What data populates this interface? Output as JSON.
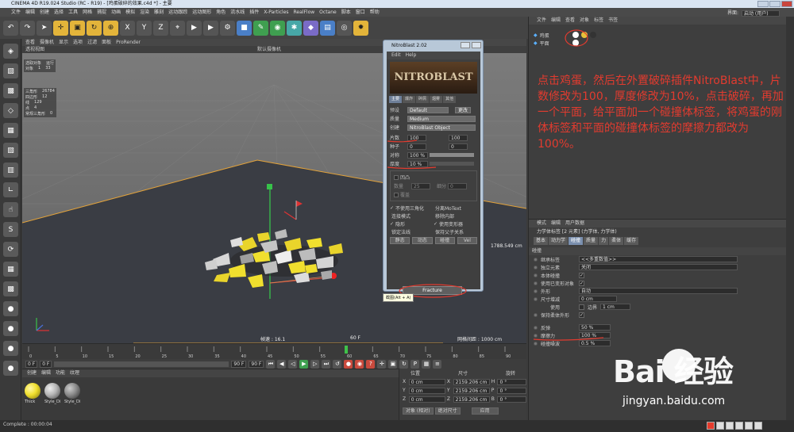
{
  "window": {
    "title": "CINEMA 4D R19.024 Studio (RC - R19) - [鸡蛋破碎的效果.c4d *] - 主要"
  },
  "menubar": {
    "items": [
      "文件",
      "编辑",
      "创建",
      "选择",
      "工具",
      "网格",
      "捕捉",
      "动画",
      "模拟",
      "渲染",
      "雕刻",
      "运动跟踪",
      "运动图形",
      "角色",
      "流水线",
      "插件",
      "X-Particles",
      "RealFlow",
      "Octane",
      "脚本",
      "窗口",
      "帮助"
    ],
    "layout_label": "界面:",
    "layout_value": "启动 (用户)"
  },
  "viewport": {
    "menu": [
      "查看",
      "摄像机",
      "显示",
      "选项",
      "过滤",
      "面板",
      "ProRender"
    ],
    "view_name": "透视视图",
    "camera_label": "默认摄像机",
    "stats_header": [
      "选取对象",
      "运行"
    ],
    "stats_header_row": [
      "对象",
      "1",
      "33"
    ],
    "stats": [
      {
        "label": "三角形",
        "value": "26784"
      },
      {
        "label": "四边形",
        "value": "12"
      },
      {
        "label": "线",
        "value": "129"
      },
      {
        "label": "点",
        "value": "4"
      },
      {
        "label": "常规三角形",
        "value": "0"
      }
    ],
    "fps": "帧速 : 16.1",
    "frame_label": "60 F",
    "distance": "1788.549 cm",
    "grid_spacing": "网格间距 : 1000 cm"
  },
  "timeline": {
    "ticks": [
      "0",
      "5",
      "10",
      "15",
      "20",
      "25",
      "30",
      "35",
      "40",
      "45",
      "50",
      "55",
      "60",
      "65",
      "70",
      "75",
      "80",
      "85",
      "90"
    ],
    "current_frame": 60,
    "start_field": "0 F",
    "range_start": "0 F",
    "range_end": "90 F",
    "end_field": "90 F",
    "frame_field": "60 F"
  },
  "material_panel": {
    "menu": [
      "创建",
      "编辑",
      "功能",
      "纹理"
    ],
    "materials": [
      {
        "name": "Thick",
        "color": "#f0df2e"
      },
      {
        "name": "Style_Di",
        "color": "#b5b5b5"
      },
      {
        "name": "Style_Di",
        "color": "#8a8a8a"
      }
    ]
  },
  "coordinates": {
    "headers": [
      "位置",
      "尺寸",
      "旋转"
    ],
    "rows": [
      {
        "axis": "X",
        "pos": "0 cm",
        "size": "2159.206 cm",
        "rot_axis": "H",
        "rot": "0 °"
      },
      {
        "axis": "Y",
        "pos": "0 cm",
        "size": "2159.206 cm",
        "rot_axis": "P",
        "rot": "0 °"
      },
      {
        "axis": "Z",
        "pos": "0 cm",
        "size": "2159.206 cm",
        "rot_axis": "B",
        "rot": "0 °"
      }
    ],
    "mode": "对象 (相对)",
    "size_mode": "绝对尺寸",
    "apply": "应用"
  },
  "object_manager": {
    "menu": [
      "文件",
      "编辑",
      "查看",
      "对象",
      "标签",
      "书签"
    ],
    "objects": [
      {
        "name": "鸡蛋",
        "tags": [
          "#ffffff",
          "#e8c23a",
          "#333333"
        ]
      },
      {
        "name": "平面",
        "tags": [
          "#ffffff"
        ]
      }
    ]
  },
  "attributes": {
    "menu": [
      "模式",
      "编辑",
      "用户数据"
    ],
    "title": "力学体标签 [2 元素] (力学体, 力学体)",
    "tabs": [
      {
        "label": "基本",
        "on": false
      },
      {
        "label": "动力学",
        "on": false
      },
      {
        "label": "碰撞",
        "on": true
      },
      {
        "label": "质量",
        "on": false
      },
      {
        "label": "力",
        "on": false
      },
      {
        "label": "柔体",
        "on": false
      },
      {
        "label": "缓存",
        "on": false
      }
    ],
    "section": "碰撞",
    "rows": [
      {
        "label": "继承标签",
        "value": "<<多重数值>>",
        "type": "select"
      },
      {
        "label": "独立元素",
        "value": "关闭",
        "type": "select"
      },
      {
        "label": "本体碰撞",
        "value": "✓",
        "type": "check"
      },
      {
        "label": "使用已变形对象",
        "value": "✓",
        "type": "check"
      },
      {
        "label": "外形",
        "value": "自动",
        "type": "select"
      },
      {
        "label": "尺寸增减",
        "value": "0 cm",
        "type": "field"
      },
      {
        "label": "使用",
        "value": "边界",
        "value2": "1 cm",
        "type": "double"
      },
      {
        "label": "保持柔体外形",
        "value": "✓",
        "type": "check"
      },
      {
        "label": "反弹",
        "value": "50 %",
        "type": "field"
      },
      {
        "label": "摩擦力",
        "value": "100 %",
        "type": "field"
      },
      {
        "label": "碰撞噪波",
        "value": "0.5 %",
        "type": "field"
      }
    ]
  },
  "nitroblast": {
    "title": "NitroBlast 2.02",
    "menu": [
      "Edit",
      "Help"
    ],
    "logo": "NITROBLAST",
    "tabs": [
      {
        "label": "主要",
        "on": true
      },
      {
        "label": "爆炸",
        "on": false
      },
      {
        "label": "碎屑",
        "on": false
      },
      {
        "label": "烟雾",
        "on": false
      },
      {
        "label": "其他",
        "on": false
      }
    ],
    "preset_label": "预设",
    "preset_value": "Default",
    "preset_btn": "更改",
    "quality_label": "质量",
    "quality_value": "Medium",
    "create_label": "创建",
    "create_value": "NitroBlast Object",
    "pieces_label": "片数",
    "pieces_value": "100",
    "pieces_value2": "100",
    "seed_label": "种子",
    "seed_value": "0",
    "seed_value2": "0",
    "mirror_label": "对称",
    "mirror_value": "100 %",
    "thickness_label": "厚度",
    "thickness_value": "10 %",
    "explode_label": "凹凸",
    "count_label": "数量",
    "count_value": "25",
    "smooth_label": "细分",
    "smooth_value": "0",
    "cap_label": "覆盖",
    "options": [
      "不使用三角化",
      "分离MoText",
      "连接模式",
      "移除内部",
      "隐形",
      "使用变形器",
      "锁定法线",
      "保持父子关系"
    ],
    "options_checked": [
      true,
      false,
      false,
      false,
      true,
      true,
      false,
      false
    ],
    "buttons": [
      "静态",
      "动态",
      "碰撞",
      "Vel"
    ],
    "fracture": "Fracture",
    "tooltip": "截图(Alt + A)"
  },
  "annotation": "点击鸡蛋，然后在外置破碎插件NitroBlast中，片数修改为100，厚度修改为10%，点击破碎，再加一个平面，给平面加一个碰撞体标签，将鸡蛋的刚体标签和平面的碰撞体标签的摩擦力都改为100%。",
  "watermark": {
    "brand": "Bai  经验",
    "url": "jingyan.baidu.com"
  },
  "status": "Complete : 00:00:04",
  "colors": {
    "annotation": "#e23b2f",
    "egg_shard": "#f0df2e",
    "accent": "#e3b43a"
  }
}
